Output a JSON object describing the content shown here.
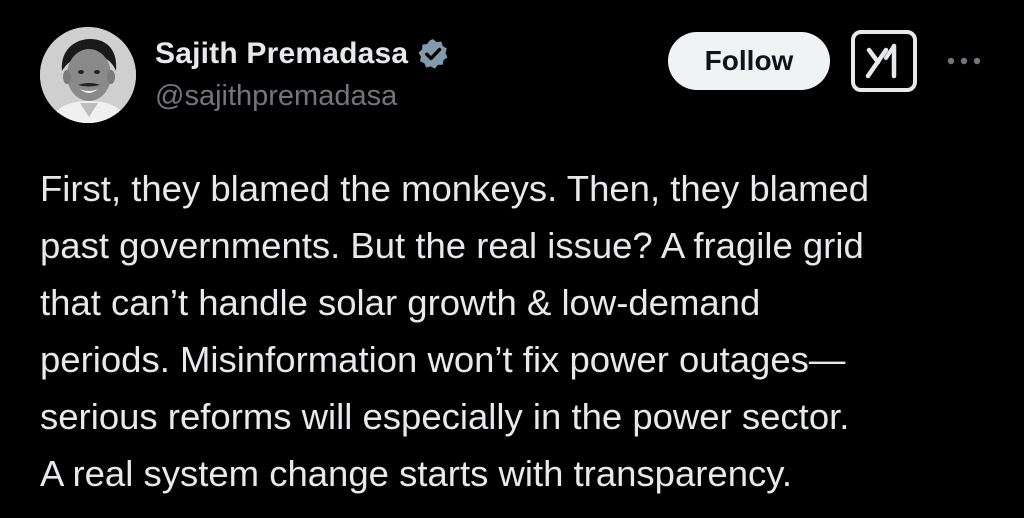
{
  "author": {
    "display_name": "Sajith Premadasa",
    "handle": "@sajithpremadasa",
    "verified": true,
    "verified_badge_color": "#829aab",
    "avatar_icon": "profile-photo"
  },
  "actions": {
    "follow_label": "Follow",
    "grok_icon": "grok-icon",
    "more_icon": "more-dots-icon"
  },
  "tweet": {
    "lines": [
      "First, they blamed the monkeys. Then, they blamed",
      "past governments. But the real issue? A fragile grid",
      "that can’t handle solar growth & low-demand",
      "periods. Misinformation won’t fix power outages—",
      "serious reforms will especially in the power sector.",
      "A real system change starts with transparency."
    ]
  },
  "colors": {
    "background": "#000000",
    "text": "#e7e9ea",
    "secondary_text": "#71767b",
    "follow_bg": "#eff3f4",
    "follow_text": "#0f1419"
  }
}
